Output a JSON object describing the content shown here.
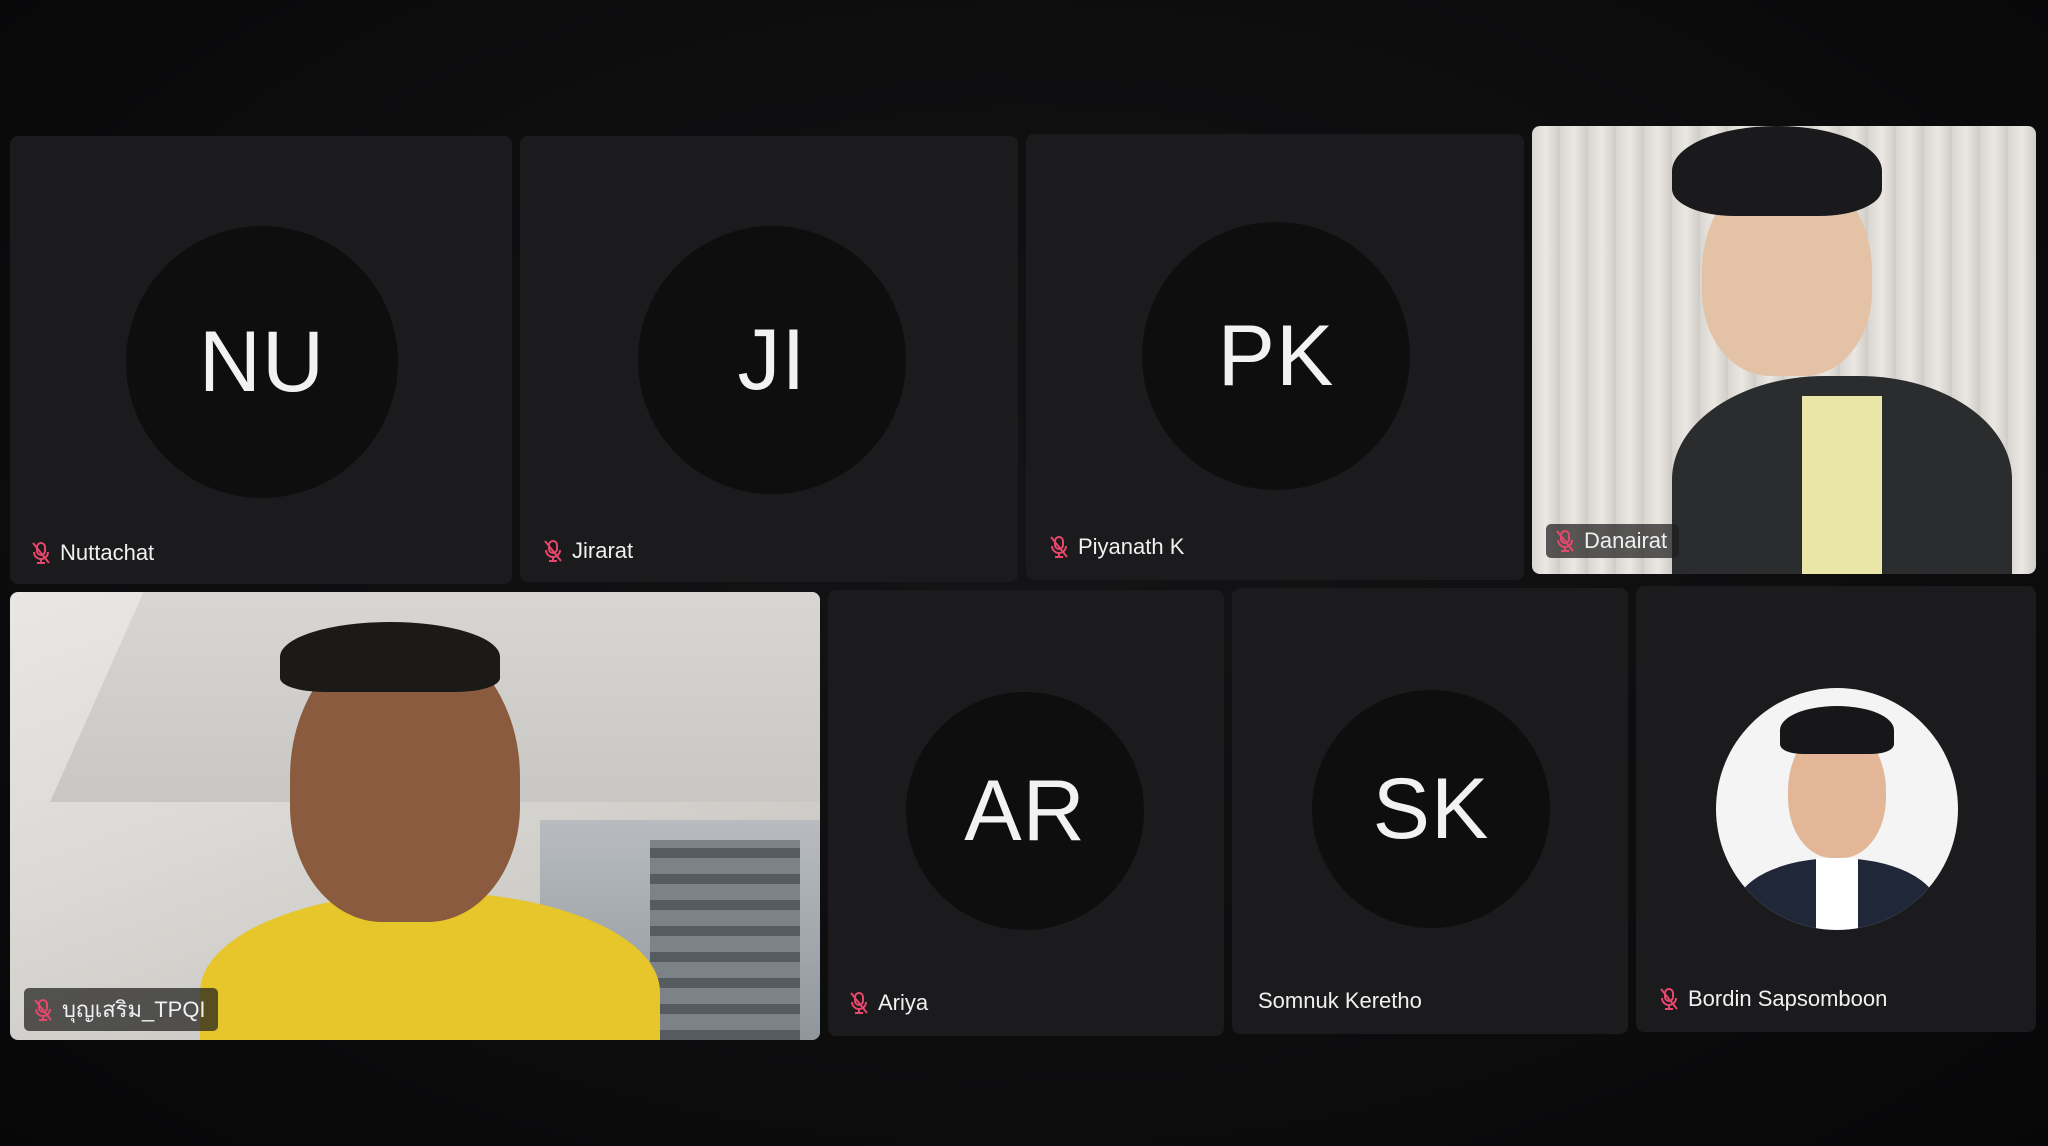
{
  "participants": [
    {
      "id": "nuttachat",
      "initials": "NU",
      "name": "Nuttachat",
      "muted": true
    },
    {
      "id": "jirarat",
      "initials": "JI",
      "name": "Jirarat",
      "muted": true
    },
    {
      "id": "piyanath",
      "initials": "PK",
      "name": "Piyanath K",
      "muted": true
    },
    {
      "id": "danairat",
      "name": "Danairat",
      "muted": true,
      "video": true
    },
    {
      "id": "boon",
      "name": "บุญเสริม_TPQI",
      "muted": true,
      "video": true
    },
    {
      "id": "ariya",
      "initials": "AR",
      "name": "Ariya",
      "muted": true
    },
    {
      "id": "somnuk",
      "initials": "SK",
      "name": "Somnuk Keretho",
      "muted": false
    },
    {
      "id": "bordin",
      "name": "Bordin Sapsomboon",
      "muted": true,
      "profile_photo": true
    }
  ],
  "colors": {
    "tile_bg": "#1b1b1d",
    "avatar_bg": "#0e0e0f",
    "muted_icon": "#e6476a",
    "text": "#f0f0f0"
  },
  "icons": {
    "muted": "microphone-off-icon"
  }
}
